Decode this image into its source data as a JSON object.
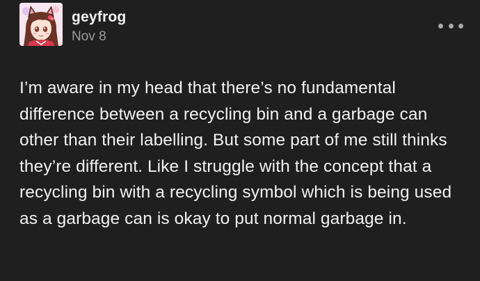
{
  "post": {
    "author": {
      "username": "geyfrog",
      "avatar_icon": "anime-avatar-icon"
    },
    "date": "Nov 8",
    "menu_icon": "more-options-icon",
    "body": "I’m aware in my head that there’s no fundamental difference between a recycling bin and a garbage can other than their labelling. But some part of me still thinks they’re different. Like I struggle with the concept that a recycling bin with a recycling symbol which is being used as a garbage can is okay to put normal garbage in."
  },
  "colors": {
    "background": "#1f1f1f",
    "text": "#f2f2f2",
    "muted": "#9c9c9c"
  }
}
